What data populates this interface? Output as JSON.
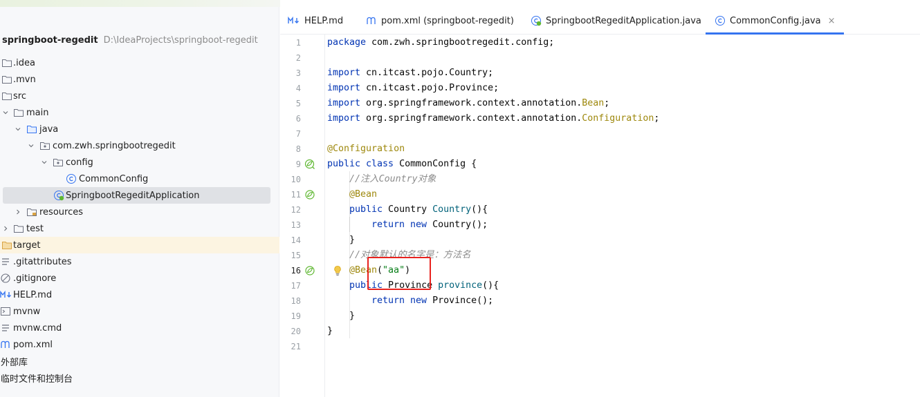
{
  "project": {
    "name": "springboot-regedit",
    "path": "D:\\IdeaProjects\\springboot-regedit"
  },
  "tree": [
    {
      "label": ".idea",
      "icon": "folder-icon"
    },
    {
      "label": ".mvn",
      "icon": "folder-icon"
    },
    {
      "label": "src",
      "icon": "folder-icon"
    },
    {
      "label": "main",
      "icon": "folder-icon"
    },
    {
      "label": "java",
      "icon": "source-folder-icon"
    },
    {
      "label": "com.zwh.springbootregedit",
      "icon": "package-icon"
    },
    {
      "label": "config",
      "icon": "package-icon"
    },
    {
      "label": "CommonConfig",
      "icon": "class-icon"
    },
    {
      "label": "SpringbootRegeditApplication",
      "icon": "spring-boot-class-icon"
    },
    {
      "label": "resources",
      "icon": "resources-folder-icon"
    },
    {
      "label": "test",
      "icon": "folder-icon"
    },
    {
      "label": "target",
      "icon": "folder-icon"
    },
    {
      "label": ".gitattributes",
      "icon": "text-file-icon"
    },
    {
      "label": ".gitignore",
      "icon": "gitignore-icon"
    },
    {
      "label": "HELP.md",
      "icon": "markdown-icon"
    },
    {
      "label": "mvnw",
      "icon": "terminal-file-icon"
    },
    {
      "label": "mvnw.cmd",
      "icon": "text-file-icon"
    },
    {
      "label": "pom.xml",
      "icon": "maven-icon"
    },
    {
      "label": "外部库",
      "icon": ""
    },
    {
      "label": "临时文件和控制台",
      "icon": ""
    }
  ],
  "tabs": [
    {
      "label": "HELP.md",
      "icon": "markdown-icon"
    },
    {
      "label": "pom.xml (springboot-regedit)",
      "icon": "maven-icon"
    },
    {
      "label": "SpringbootRegeditApplication.java",
      "icon": "spring-boot-class-icon"
    },
    {
      "label": "CommonConfig.java",
      "icon": "class-icon",
      "close": "×"
    }
  ],
  "line_numbers": [
    "1",
    "2",
    "3",
    "4",
    "5",
    "6",
    "7",
    "8",
    "9",
    "10",
    "11",
    "12",
    "13",
    "14",
    "15",
    "16",
    "17",
    "18",
    "19",
    "20",
    "21"
  ],
  "code": {
    "l1": {
      "kw": "package",
      "rest": " com.zwh.springbootregedit.config;"
    },
    "l3": {
      "kw": "import",
      "rest": " cn.itcast.pojo.Country;"
    },
    "l4": {
      "kw": "import",
      "rest": " cn.itcast.pojo.Province;"
    },
    "l5": {
      "kw": "import",
      "rest": " org.springframework.context.annotation.",
      "ann": "Bean",
      "end": ";"
    },
    "l6": {
      "kw": "import",
      "rest": " org.springframework.context.annotation.",
      "ann": "Configuration",
      "end": ";"
    },
    "l8": {
      "ann": "@Configuration"
    },
    "l9": {
      "kw": "public class",
      "rest": " CommonConfig {"
    },
    "l10": {
      "cmt": "//注入Country对象"
    },
    "l11": {
      "ann": "@Bean"
    },
    "l12": {
      "kw": "public",
      "type": " Country ",
      "fn": "Country",
      "rest": "(){"
    },
    "l13": {
      "kw": "return new",
      "rest": " Country();"
    },
    "l14": {
      "rest": "}"
    },
    "l15": {
      "cmt": "//对象默认的名字是：方法名"
    },
    "l16": {
      "ann": "@Bean",
      "open": "(",
      "str": "\"aa\"",
      "close": ")"
    },
    "l17": {
      "kw": "public",
      "type": " Province ",
      "fn": "province",
      "rest": "(){"
    },
    "l18": {
      "kw": "return new",
      "rest": " Province();"
    },
    "l19": {
      "rest": "}"
    },
    "l20": {
      "rest": "}"
    }
  },
  "colors": {
    "keyword": "#0033b3",
    "annotation": "#9e880d",
    "comment": "#8c8c8c",
    "string": "#067d17",
    "method": "#00627a",
    "active_tab": "#3574f0",
    "highlight_box": "#e8221e"
  }
}
